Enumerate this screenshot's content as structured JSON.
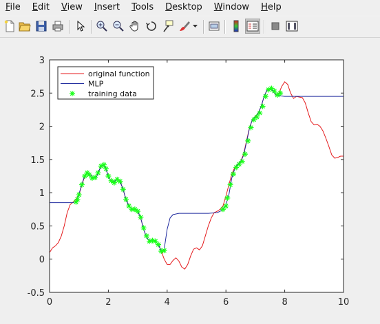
{
  "menubar": {
    "items": [
      {
        "acc": "F",
        "rest": "ile"
      },
      {
        "acc": "E",
        "rest": "dit"
      },
      {
        "acc": "V",
        "rest": "iew"
      },
      {
        "acc": "I",
        "rest": "nsert"
      },
      {
        "acc": "T",
        "rest": "ools"
      },
      {
        "acc": "D",
        "rest": "esktop"
      },
      {
        "acc": "W",
        "rest": "indow"
      },
      {
        "acc": "H",
        "rest": "elp"
      }
    ]
  },
  "toolbar": {
    "icons": [
      "new-file-icon",
      "open-folder-icon",
      "save-icon",
      "print-icon",
      "pointer-icon",
      "zoom-in-icon",
      "zoom-out-icon",
      "pan-hand-icon",
      "data-cursor-icon",
      "rotate-3d-icon",
      "brush-icon",
      "brush-dropdown-icon",
      "link-plot-icon",
      "colorbar-icon",
      "legend-icon",
      "hide-plot-tools-icon",
      "show-plot-tools-icon"
    ]
  },
  "chart_data": {
    "type": "line",
    "xlim": [
      0,
      10
    ],
    "ylim": [
      -0.5,
      3
    ],
    "xticks": [
      "0",
      "2",
      "4",
      "6",
      "8",
      "10"
    ],
    "yticks": [
      "-0.5",
      "0",
      "0.5",
      "1",
      "1.5",
      "2",
      "2.5",
      "3"
    ],
    "grid": false,
    "legend_position": "top-left",
    "series": [
      {
        "name": "original function",
        "color": "#e41a1c",
        "style": "line",
        "x": [
          0,
          0.1,
          0.2,
          0.3,
          0.4,
          0.5,
          0.6,
          0.7,
          0.8,
          0.9,
          1.0,
          1.1,
          1.2,
          1.3,
          1.4,
          1.5,
          1.6,
          1.7,
          1.8,
          1.9,
          2.0,
          2.1,
          2.2,
          2.3,
          2.4,
          2.5,
          2.6,
          2.7,
          2.8,
          2.9,
          3.0,
          3.1,
          3.2,
          3.3,
          3.4,
          3.5,
          3.6,
          3.7,
          3.8,
          3.9,
          4.0,
          4.1,
          4.2,
          4.3,
          4.4,
          4.5,
          4.6,
          4.7,
          4.8,
          4.9,
          5.0,
          5.1,
          5.2,
          5.3,
          5.4,
          5.5,
          5.6,
          5.7,
          5.8,
          5.9,
          6.0,
          6.1,
          6.2,
          6.3,
          6.4,
          6.5,
          6.6,
          6.7,
          6.8,
          6.9,
          7.0,
          7.1,
          7.2,
          7.3,
          7.4,
          7.5,
          7.6,
          7.7,
          7.8,
          7.9,
          8.0,
          8.1,
          8.2,
          8.3,
          8.4,
          8.5,
          8.6,
          8.7,
          8.8,
          8.9,
          9.0,
          9.1,
          9.2,
          9.3,
          9.4,
          9.5,
          9.6,
          9.7,
          9.8,
          9.9,
          10.0
        ],
        "y": [
          0.1,
          0.17,
          0.2,
          0.25,
          0.35,
          0.5,
          0.7,
          0.82,
          0.86,
          0.9,
          0.97,
          1.12,
          1.25,
          1.3,
          1.27,
          1.22,
          1.25,
          1.35,
          1.42,
          1.38,
          1.25,
          1.17,
          1.17,
          1.2,
          1.17,
          1.05,
          0.9,
          0.8,
          0.75,
          0.75,
          0.72,
          0.62,
          0.45,
          0.33,
          0.27,
          0.28,
          0.27,
          0.22,
          0.12,
          0.0,
          -0.08,
          -0.08,
          -0.02,
          0.02,
          -0.03,
          -0.12,
          -0.15,
          -0.08,
          0.05,
          0.15,
          0.17,
          0.14,
          0.2,
          0.35,
          0.5,
          0.62,
          0.7,
          0.72,
          0.75,
          0.8,
          0.95,
          1.12,
          1.28,
          1.38,
          1.43,
          1.47,
          1.58,
          1.78,
          1.98,
          2.1,
          2.15,
          2.2,
          2.3,
          2.45,
          2.55,
          2.57,
          2.53,
          2.47,
          2.5,
          2.6,
          2.67,
          2.63,
          2.5,
          2.42,
          2.45,
          2.44,
          2.43,
          2.35,
          2.2,
          2.07,
          2.02,
          2.03,
          2.0,
          1.93,
          1.82,
          1.7,
          1.57,
          1.52,
          1.53,
          1.55,
          1.55
        ]
      },
      {
        "name": "MLP",
        "color": "#1f2a9e",
        "style": "line",
        "x": [
          0,
          0.5,
          0.8,
          0.9,
          1.0,
          1.1,
          1.2,
          1.3,
          1.4,
          1.5,
          1.6,
          1.7,
          1.8,
          1.9,
          2.0,
          2.1,
          2.2,
          2.3,
          2.4,
          2.5,
          2.6,
          2.7,
          2.8,
          2.9,
          3.0,
          3.1,
          3.2,
          3.3,
          3.4,
          3.5,
          3.6,
          3.7,
          3.8,
          3.9,
          4.0,
          4.1,
          4.2,
          4.4,
          4.7,
          5.0,
          5.4,
          5.7,
          5.8,
          5.9,
          6.0,
          6.1,
          6.2,
          6.3,
          6.4,
          6.5,
          6.6,
          6.7,
          6.8,
          6.9,
          7.0,
          7.1,
          7.2,
          7.3,
          7.4,
          7.5,
          7.6,
          7.7,
          7.8,
          8.0,
          8.5,
          9.0,
          10.0
        ],
        "y": [
          0.85,
          0.85,
          0.85,
          0.87,
          0.98,
          1.13,
          1.26,
          1.3,
          1.27,
          1.22,
          1.24,
          1.35,
          1.42,
          1.38,
          1.25,
          1.17,
          1.17,
          1.2,
          1.17,
          1.05,
          0.9,
          0.8,
          0.75,
          0.75,
          0.72,
          0.62,
          0.45,
          0.33,
          0.27,
          0.28,
          0.27,
          0.22,
          0.12,
          0.15,
          0.45,
          0.62,
          0.67,
          0.69,
          0.69,
          0.69,
          0.69,
          0.7,
          0.72,
          0.75,
          0.82,
          0.97,
          1.22,
          1.36,
          1.43,
          1.47,
          1.56,
          1.76,
          1.97,
          2.1,
          2.14,
          2.2,
          2.3,
          2.45,
          2.55,
          2.57,
          2.53,
          2.47,
          2.46,
          2.45,
          2.45,
          2.45,
          2.45
        ]
      },
      {
        "name": "training data",
        "color": "#19ff19",
        "style": "markers",
        "x": [
          0.9,
          0.95,
          1.0,
          1.1,
          1.2,
          1.28,
          1.35,
          1.45,
          1.55,
          1.65,
          1.75,
          1.85,
          1.92,
          2.0,
          2.1,
          2.2,
          2.3,
          2.4,
          2.5,
          2.6,
          2.7,
          2.8,
          2.9,
          3.0,
          3.1,
          3.2,
          3.3,
          3.4,
          3.5,
          3.6,
          3.7,
          3.8,
          3.9,
          5.9,
          6.0,
          6.05,
          6.15,
          6.25,
          6.35,
          6.45,
          6.55,
          6.65,
          6.75,
          6.85,
          6.95,
          7.05,
          7.15,
          7.25,
          7.35,
          7.45,
          7.55,
          7.65,
          7.75,
          7.85
        ],
        "y": [
          0.86,
          0.9,
          0.97,
          1.12,
          1.25,
          1.3,
          1.27,
          1.22,
          1.23,
          1.3,
          1.4,
          1.42,
          1.36,
          1.25,
          1.18,
          1.15,
          1.2,
          1.17,
          1.05,
          0.9,
          0.8,
          0.75,
          0.75,
          0.72,
          0.63,
          0.47,
          0.35,
          0.27,
          0.28,
          0.27,
          0.22,
          0.12,
          0.13,
          0.75,
          0.8,
          0.92,
          1.12,
          1.28,
          1.38,
          1.43,
          1.47,
          1.58,
          1.78,
          1.98,
          2.1,
          2.14,
          2.2,
          2.3,
          2.45,
          2.55,
          2.57,
          2.53,
          2.47,
          2.5
        ]
      }
    ]
  }
}
